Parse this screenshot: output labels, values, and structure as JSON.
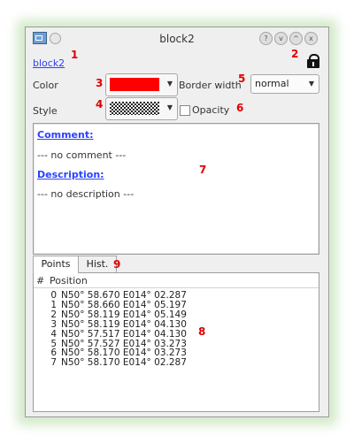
{
  "window": {
    "title": "block2",
    "buttons": [
      "?",
      "v",
      "^",
      "x"
    ]
  },
  "header": {
    "block_link": "block2",
    "lock_icon": "lock-icon"
  },
  "annotations": {
    "n1": "1",
    "n2": "2",
    "n3": "3",
    "n4": "4",
    "n5": "5",
    "n6": "6",
    "n7": "7",
    "n8": "8",
    "n9": "9"
  },
  "properties": {
    "color_label": "Color",
    "color_value": "#ff0000",
    "border_width_label": "Border width",
    "border_width_value": "normal",
    "style_label": "Style",
    "opacity_label": "Opacity",
    "opacity_checked": false
  },
  "details": {
    "comment_heading": "Comment:",
    "comment_text": "--- no comment ---",
    "description_heading": "Description:",
    "description_text": "--- no description ---"
  },
  "tabs": [
    {
      "label": "Points",
      "active": true
    },
    {
      "label": "Hist.",
      "active": false
    }
  ],
  "points_table": {
    "columns": [
      "#",
      "Position"
    ],
    "rows": [
      {
        "index": "0",
        "position": "N50° 58.670 E014° 02.287"
      },
      {
        "index": "1",
        "position": "N50° 58.660 E014° 05.197"
      },
      {
        "index": "2",
        "position": "N50° 58.119 E014° 05.149"
      },
      {
        "index": "3",
        "position": "N50° 58.119 E014° 04.130"
      },
      {
        "index": "4",
        "position": "N50° 57.517 E014° 04.130"
      },
      {
        "index": "5",
        "position": "N50° 57.527 E014° 03.273"
      },
      {
        "index": "6",
        "position": "N50° 58.170 E014° 03.273"
      },
      {
        "index": "7",
        "position": "N50° 58.170 E014° 02.287"
      }
    ]
  }
}
